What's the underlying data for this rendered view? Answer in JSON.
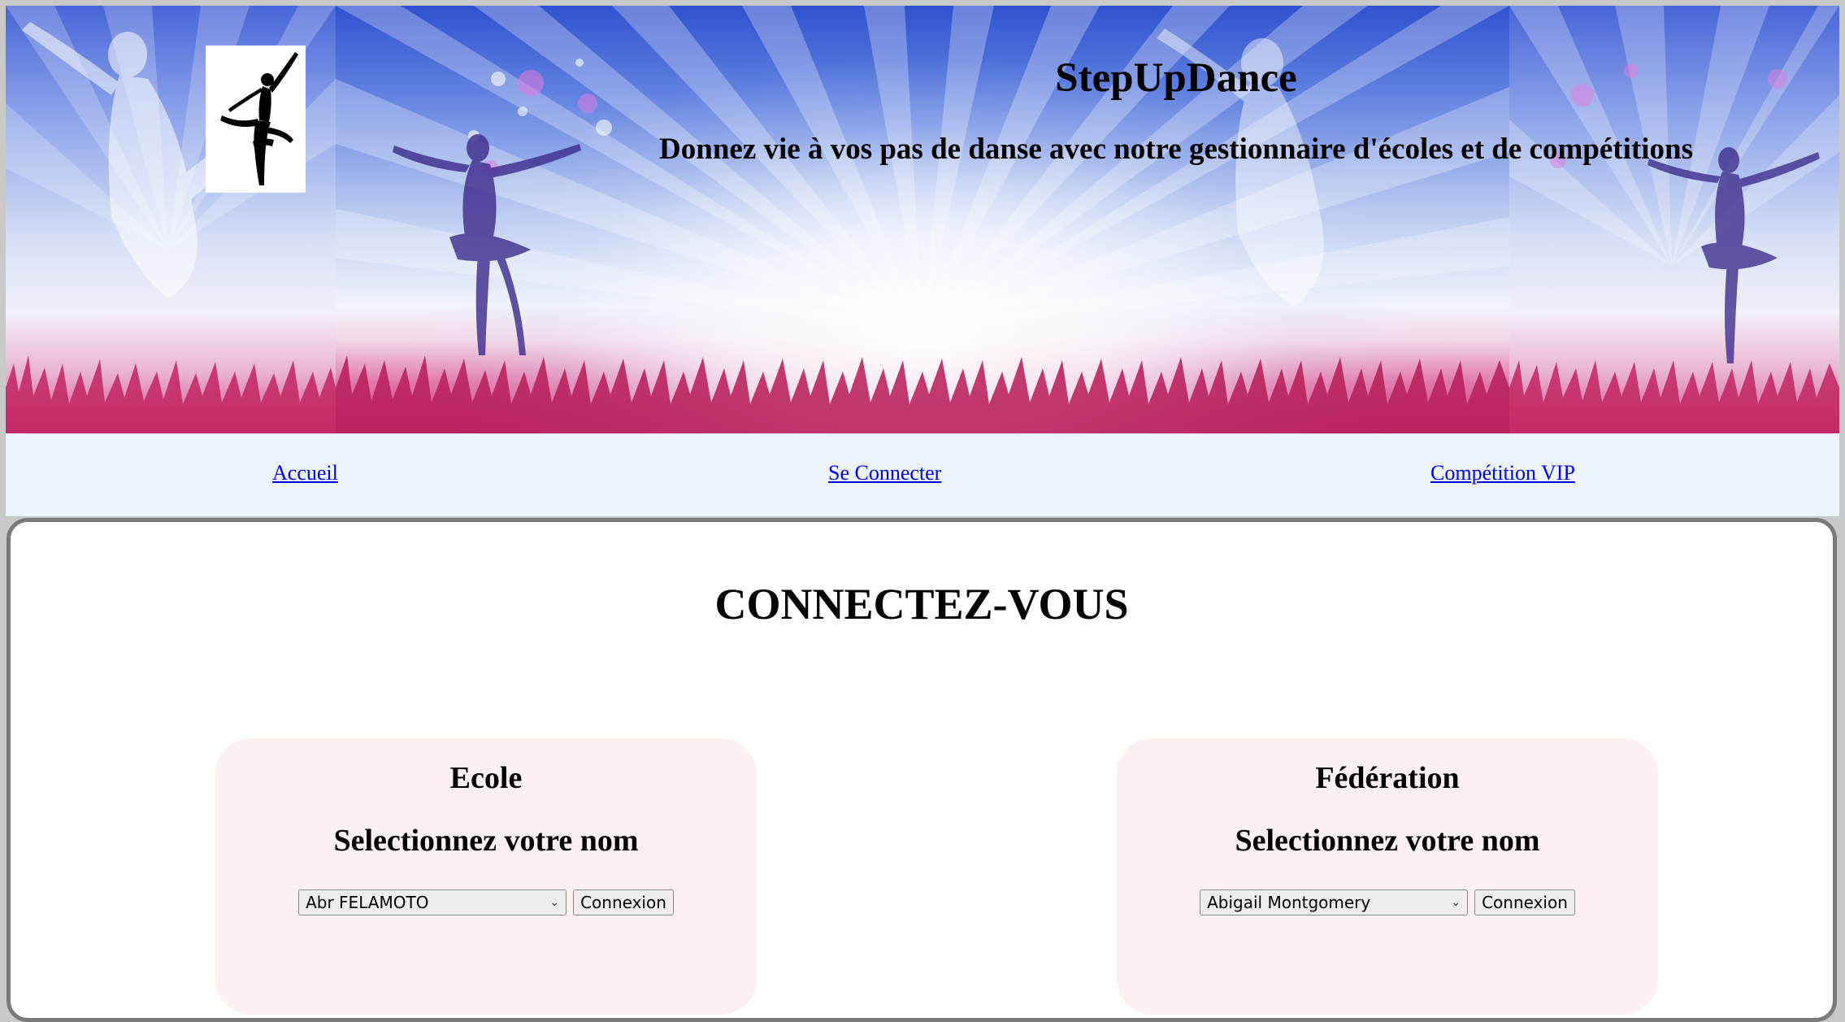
{
  "header": {
    "title": "StepUpDance",
    "subtitle": "Donnez vie à vos pas de danse avec notre gestionnaire d'écoles et de compétitions",
    "logo_icon": "ballerina-icon"
  },
  "nav": {
    "home": "Accueil",
    "login": "Se Connecter",
    "vip": "Compétition VIP"
  },
  "main": {
    "title": "CONNECTEZ-VOUS",
    "school": {
      "title": "Ecole",
      "prompt": "Selectionnez votre nom",
      "selected": "Abr FELAMOTO",
      "button": "Connexion"
    },
    "federation": {
      "title": "Fédération",
      "prompt": "Selectionnez votre nom",
      "selected": "Abigail Montgomery",
      "button": "Connexion"
    }
  },
  "colors": {
    "link": "#0000ee",
    "nav_bg": "#eef4fb",
    "box_bg": "#fcf0f0",
    "card_border": "#7a7a7a"
  }
}
